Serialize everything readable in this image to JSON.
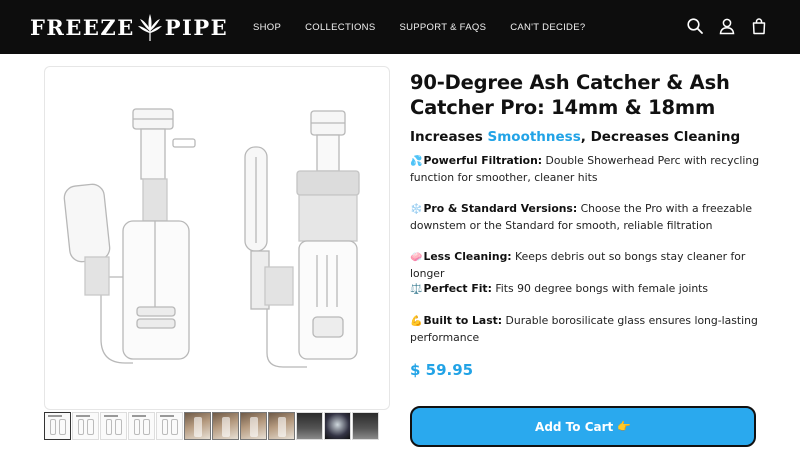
{
  "header": {
    "logo_left": "FREEZE",
    "logo_right": "PIPE",
    "nav": [
      "SHOP",
      "COLLECTIONS",
      "SUPPORT & FAQS",
      "CAN'T DECIDE?"
    ],
    "icons": [
      "search-icon",
      "account-icon",
      "bag-icon"
    ]
  },
  "product": {
    "title": "90-Degree Ash Catcher & Ash Catcher Pro: 14mm & 18mm",
    "subtitle_pre": "Increases ",
    "subtitle_highlight": "Smoothness",
    "subtitle_post": ", Decreases Cleaning",
    "features": [
      {
        "emoji": "💦",
        "label": "Powerful Filtration:",
        "text": " Double Showerhead Perc with recycling function for smoother, cleaner hits"
      },
      {
        "emoji": "❄️",
        "label": "Pro & Standard Versions:",
        "text": " Choose the Pro with a freezable downstem or the Standard for smooth, reliable filtration"
      },
      {
        "emoji": "🧼",
        "label": "Less Cleaning:",
        "text": " Keeps debris out so bongs stay cleaner for longer"
      },
      {
        "emoji": "⚖️",
        "label": "Perfect Fit:",
        "text": " Fits 90 degree bongs with female joints"
      },
      {
        "emoji": "💪",
        "label": "Built to Last:",
        "text": " Durable borosilicate glass ensures long-lasting performance"
      }
    ],
    "price": "$ 59.95",
    "cart_label": "Add To Cart",
    "cart_emoji": "👉"
  },
  "colors": {
    "header_bg": "#0d0d0d",
    "accent": "#22a3e6",
    "button": "#2aa9ee"
  }
}
